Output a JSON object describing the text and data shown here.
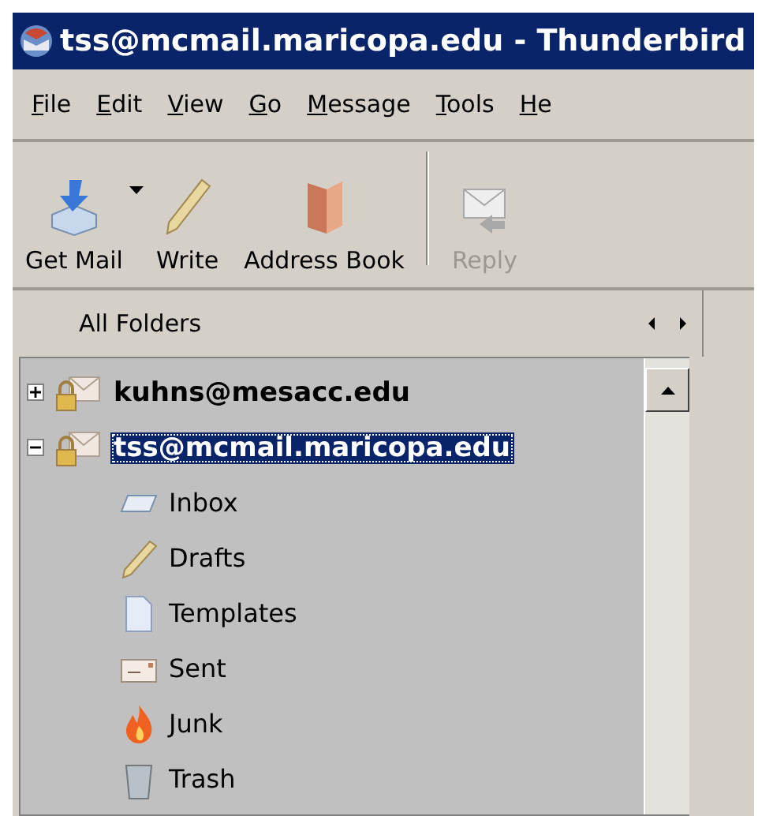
{
  "window": {
    "title": "tss@mcmail.maricopa.edu - Thunderbird"
  },
  "menu": [
    "File",
    "Edit",
    "View",
    "Go",
    "Message",
    "Tools",
    "He"
  ],
  "toolbar": [
    {
      "label": "Get Mail",
      "kind": "get-mail",
      "has_menu": true,
      "disabled": false
    },
    {
      "label": "Write",
      "kind": "write",
      "has_menu": false,
      "disabled": false
    },
    {
      "label": "Address Book",
      "kind": "address-book",
      "has_menu": false,
      "disabled": false
    },
    {
      "label": "Reply",
      "kind": "reply",
      "has_menu": false,
      "disabled": true
    }
  ],
  "folder_pane": {
    "header": "All Folders",
    "accounts": [
      {
        "name": "kuhns@mesacc.edu",
        "expanded": false,
        "selected": false
      },
      {
        "name": "tss@mcmail.maricopa.edu",
        "expanded": true,
        "selected": true,
        "children": [
          {
            "name": "Inbox",
            "kind": "inbox"
          },
          {
            "name": "Drafts",
            "kind": "drafts"
          },
          {
            "name": "Templates",
            "kind": "templates"
          },
          {
            "name": "Sent",
            "kind": "sent"
          },
          {
            "name": "Junk",
            "kind": "junk"
          },
          {
            "name": "Trash",
            "kind": "trash"
          }
        ]
      }
    ]
  }
}
